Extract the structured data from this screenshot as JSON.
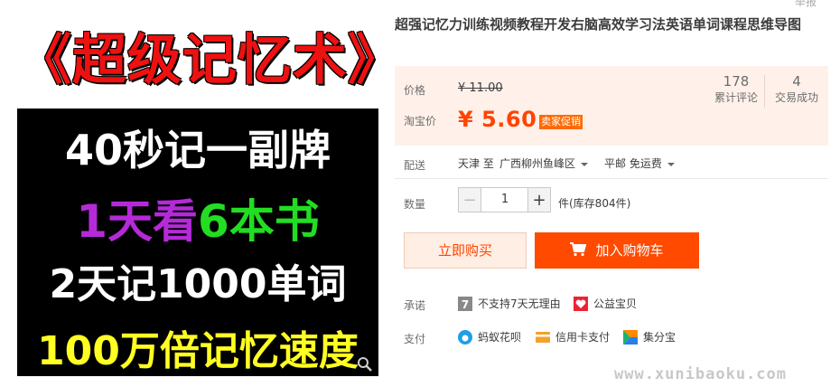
{
  "top_fragment": "举报",
  "image": {
    "title": "《超级记忆术》",
    "line1": "40秒记一副牌",
    "line2_a": "1天看",
    "line2_b": "6本书",
    "line3": "2天记1000单词",
    "line4": "100万倍记忆速度"
  },
  "product": {
    "title": "超强记忆力训练视频教程开发右脑高效学习法英语单词课程思维导图"
  },
  "price": {
    "label": "价格",
    "original": "¥ 11.00",
    "promo_label": "淘宝价",
    "promo": "¥ 5.60",
    "promo_tag": "卖家促销"
  },
  "stats": {
    "reviews_count": "178",
    "reviews_label": "累计评论",
    "sales_count": "4",
    "sales_label": "交易成功"
  },
  "shipping": {
    "label": "配送",
    "from": "天津 至",
    "to": "广西柳州鱼峰区",
    "method": "平邮 免运费"
  },
  "quantity": {
    "label": "数量",
    "minus": "−",
    "value": "1",
    "plus": "+",
    "stock": "件(库存804件)"
  },
  "buttons": {
    "buy_now": "立即购买",
    "add_to_cart": "加入购物车"
  },
  "promise": {
    "label": "承诺",
    "no_return": "不支持7天无理由",
    "charity": "公益宝贝"
  },
  "payment": {
    "label": "支付",
    "huabei": "蚂蚁花呗",
    "credit_card": "信用卡支付",
    "jifenbao": "集分宝"
  },
  "watermark": "www.xunibaoku.com"
}
